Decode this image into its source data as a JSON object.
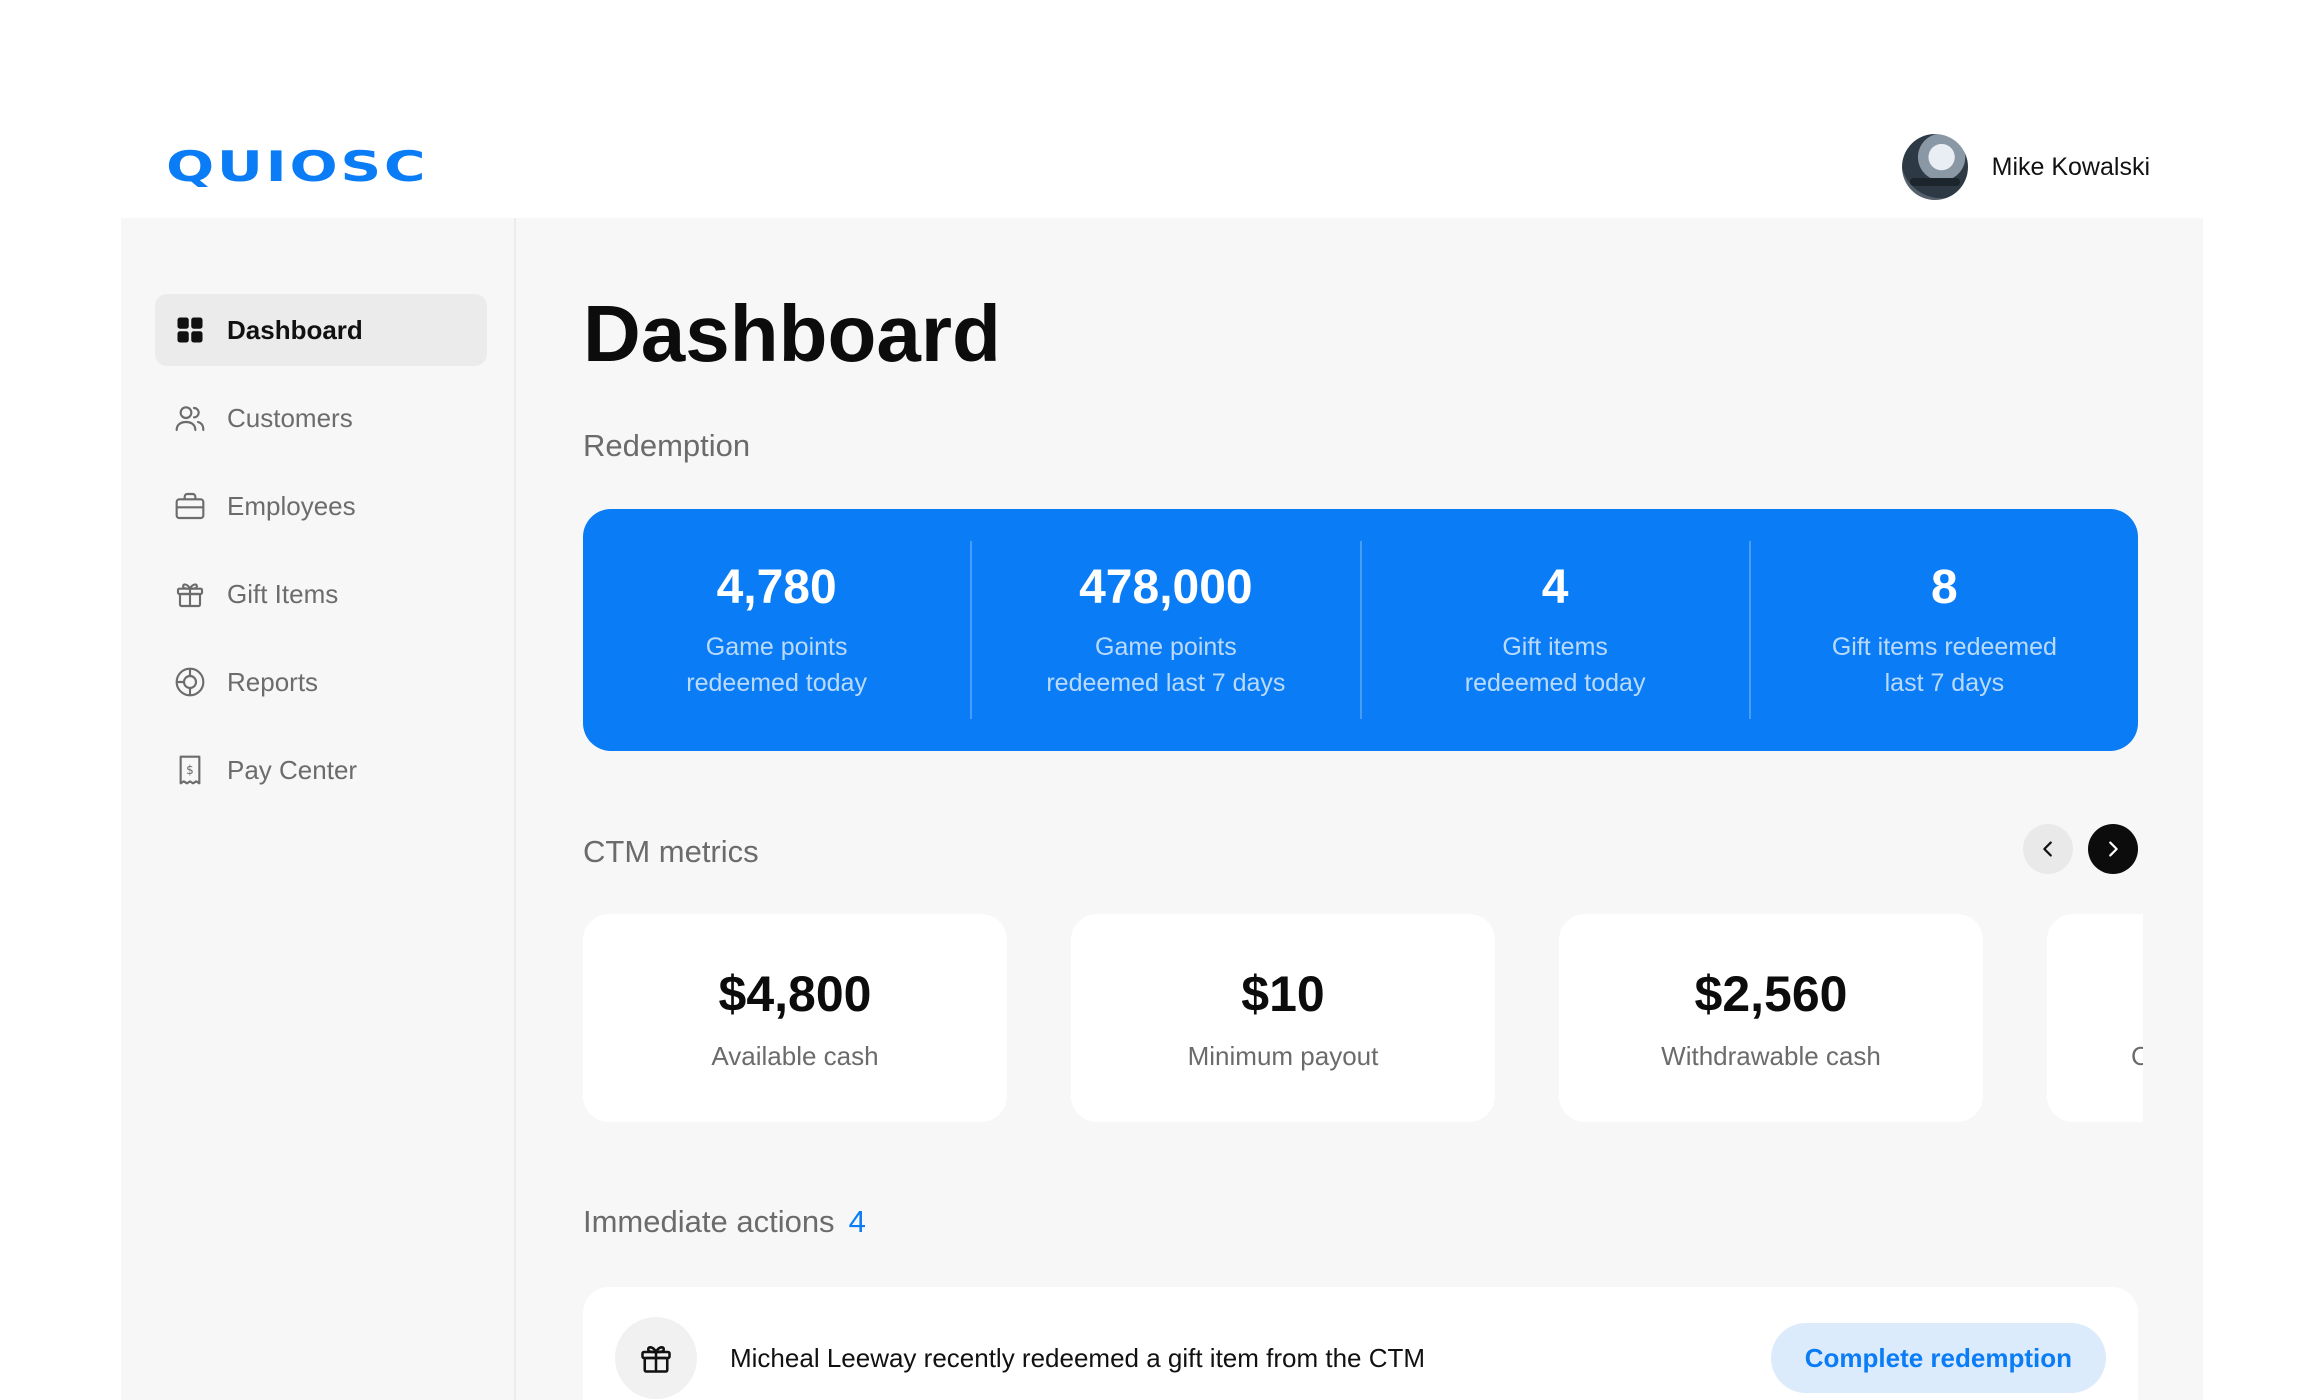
{
  "brand": {
    "logo_text": "QUIOSC",
    "accent_color": "#0a7cf5"
  },
  "user": {
    "name": "Mike Kowalski",
    "avatar_icon": "user-photo"
  },
  "sidebar": {
    "items": [
      {
        "label": "Dashboard",
        "icon": "grid-icon",
        "active": true
      },
      {
        "label": "Customers",
        "icon": "users-icon",
        "active": false
      },
      {
        "label": "Employees",
        "icon": "briefcase-icon",
        "active": false
      },
      {
        "label": "Gift Items",
        "icon": "gift-icon",
        "active": false
      },
      {
        "label": "Reports",
        "icon": "reports-icon",
        "active": false
      },
      {
        "label": "Pay Center",
        "icon": "receipt-icon",
        "active": false
      }
    ]
  },
  "main": {
    "title": "Dashboard",
    "redemption": {
      "label": "Redemption",
      "stats": [
        {
          "value": "4,780",
          "label": "Game points\nredeemed today"
        },
        {
          "value": "478,000",
          "label": "Game points\nredeemed last 7 days"
        },
        {
          "value": "4",
          "label": "Gift items\nredeemed today"
        },
        {
          "value": "8",
          "label": "Gift items redeemed\nlast 7 days"
        }
      ]
    },
    "ctm": {
      "label": "CTM metrics",
      "metrics": [
        {
          "value": "$4,800",
          "label": "Available cash"
        },
        {
          "value": "$10",
          "label": "Minimum payout"
        },
        {
          "value": "$2,560",
          "label": "Withdrawable cash"
        },
        {
          "value": "",
          "label": "Cash v"
        }
      ]
    },
    "actions": {
      "label": "Immediate actions",
      "count": "4",
      "items": [
        {
          "text": "Micheal Leeway recently redeemed a gift item from the CTM",
          "button": "Complete redemption",
          "icon": "gift-icon"
        }
      ]
    }
  }
}
